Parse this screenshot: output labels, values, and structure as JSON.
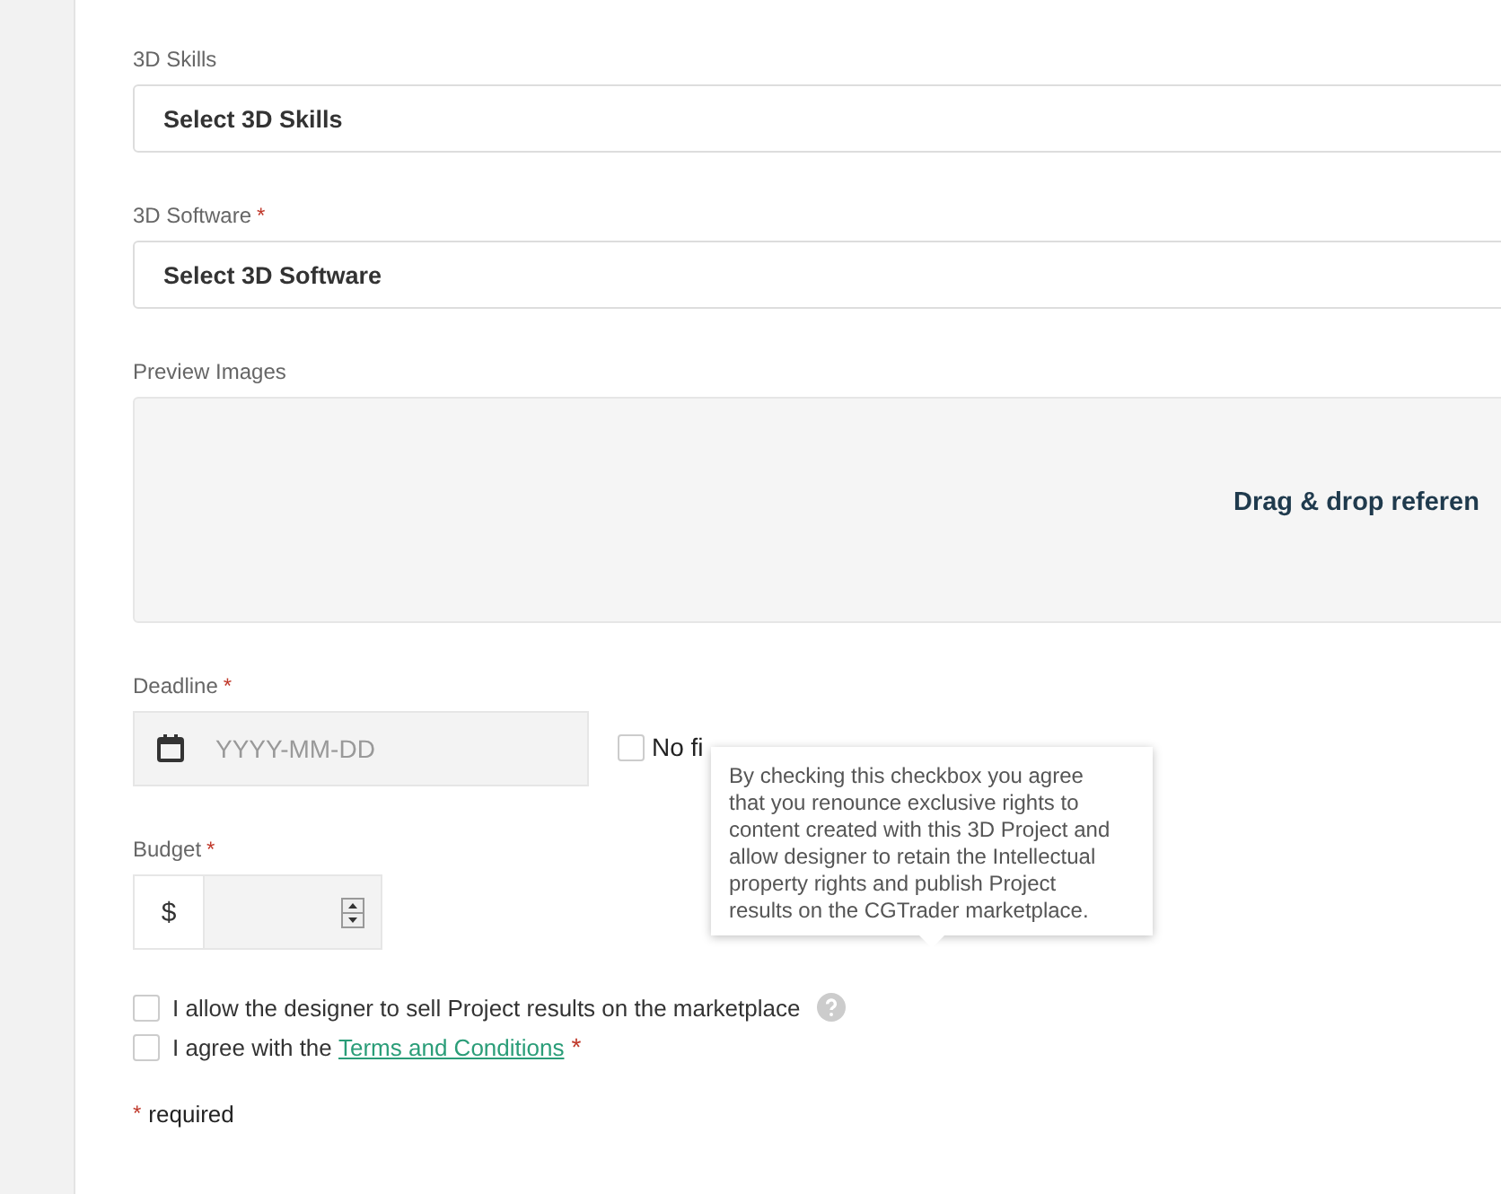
{
  "skills": {
    "label": "3D Skills",
    "required": false,
    "value": "Select 3D Skills"
  },
  "software": {
    "label": "3D Software",
    "required": true,
    "value": "Select 3D Software"
  },
  "preview": {
    "label": "Preview Images",
    "dropzone_text": "Drag & drop referen"
  },
  "deadline": {
    "label": "Deadline",
    "required": true,
    "placeholder": "YYYY-MM-DD",
    "no_fixed": {
      "label": "No fi",
      "checked": false
    }
  },
  "budget": {
    "label": "Budget",
    "required": true,
    "currency": "$"
  },
  "tooltip": "By checking this checkbox you agree that you renounce exclusive rights to content created with this 3D Project and allow designer to retain the Intellectual property rights and publish Project results on the CGTrader marketplace.",
  "agreements": [
    {
      "text": "I allow the designer to sell Project results on the marketplace",
      "checked": false,
      "help": true
    },
    {
      "text": "I agree with the ",
      "link": "Terms and Conditions",
      "required": true,
      "checked": false,
      "help": false
    }
  ],
  "required_note": {
    "mark": "*",
    "text": "required"
  }
}
